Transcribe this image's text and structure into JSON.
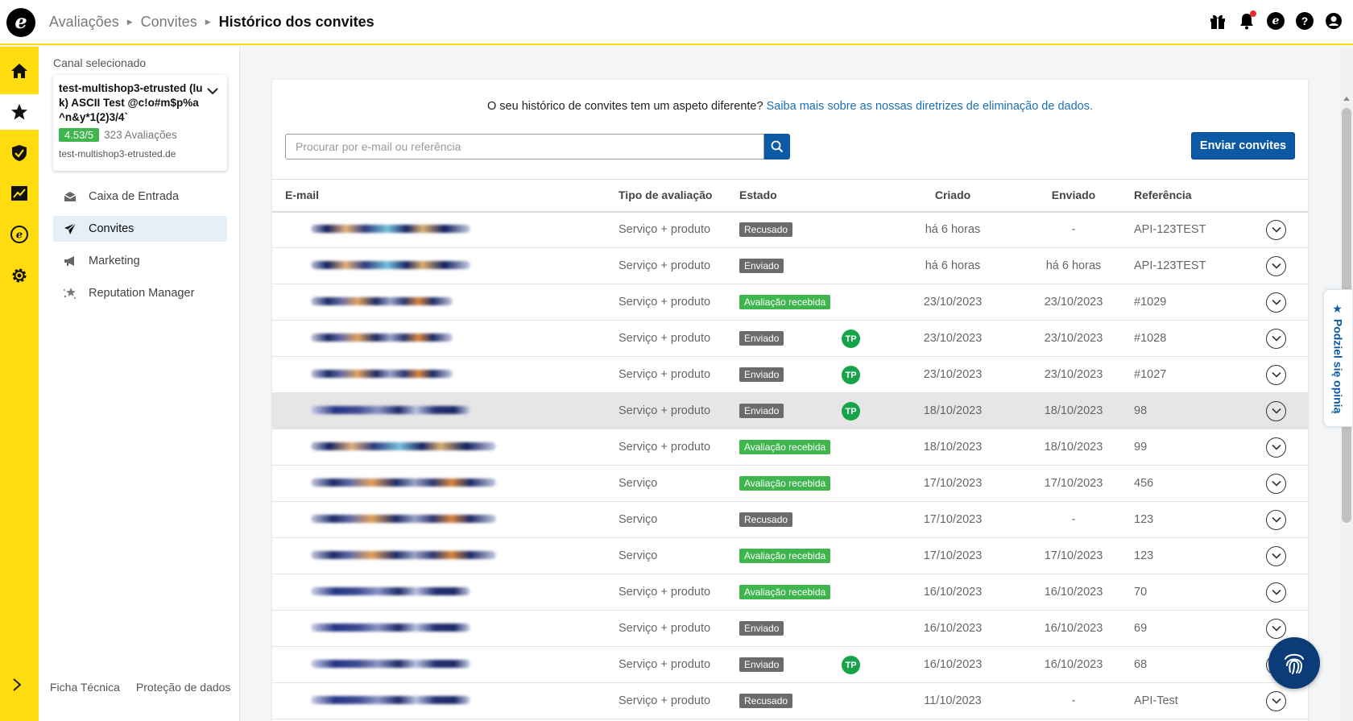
{
  "header": {
    "logo_letter": "e",
    "breadcrumb": [
      "Avaliações",
      "Convites"
    ],
    "current": "Histórico dos convites",
    "icons": [
      "gift-icon",
      "bell-icon",
      "trusted-logo-icon",
      "help-icon",
      "user-icon"
    ]
  },
  "rail": {
    "items": [
      "home-icon",
      "star-icon",
      "shield-icon",
      "chart-icon",
      "trusted-e-icon",
      "gear-icon"
    ],
    "active": "star-icon"
  },
  "sidebar": {
    "channel_label": "Canal selecionado",
    "channel_name": "test-multishop3-etrusted (luk) ASCII Test @c!o#m$p%a^n&y*1(2)3/4`",
    "rating": "4.53/5",
    "review_count": "323 Avaliações",
    "domain": "test-multishop3-etrusted.de",
    "nav": [
      {
        "label": "Caixa de Entrada",
        "icon": "inbox-icon"
      },
      {
        "label": "Convites",
        "icon": "send-icon"
      },
      {
        "label": "Marketing",
        "icon": "megaphone-icon"
      },
      {
        "label": "Reputation Manager",
        "icon": "sparkle-icon"
      }
    ],
    "footer": [
      "Ficha Técnica",
      "Proteção de dados"
    ]
  },
  "main": {
    "notice_text": "O seu histórico de convites tem um aspeto diferente?",
    "notice_link": "Saiba mais sobre as nossas diretrizes de eliminação de dados.",
    "search_placeholder": "Procurar por e-mail ou referência",
    "send_button": "Enviar convites",
    "columns": [
      "E-mail",
      "Tipo de avaliação",
      "Estado",
      "Criado",
      "Enviado",
      "Referência"
    ],
    "rows": [
      {
        "type": "Serviço + produto",
        "state": "Recusado",
        "tp": false,
        "created": "há 6 horas",
        "sent": "-",
        "ref": "API-123TEST",
        "mail_width": 198,
        "variant": "c"
      },
      {
        "type": "Serviço + produto",
        "state": "Enviado",
        "tp": false,
        "created": "há 6 horas",
        "sent": "há 6 horas",
        "ref": "API-123TEST",
        "mail_width": 198,
        "variant": "c"
      },
      {
        "type": "Serviço + produto",
        "state": "Avaliação recebida",
        "tp": false,
        "created": "23/10/2023",
        "sent": "23/10/2023",
        "ref": "#1029",
        "mail_width": 176,
        "variant": "a"
      },
      {
        "type": "Serviço + produto",
        "state": "Enviado",
        "tp": true,
        "created": "23/10/2023",
        "sent": "23/10/2023",
        "ref": "#1028",
        "mail_width": 176,
        "variant": "a"
      },
      {
        "type": "Serviço + produto",
        "state": "Enviado",
        "tp": true,
        "created": "23/10/2023",
        "sent": "23/10/2023",
        "ref": "#1027",
        "mail_width": 176,
        "variant": "a"
      },
      {
        "type": "Serviço + produto",
        "state": "Enviado",
        "tp": true,
        "created": "18/10/2023",
        "sent": "18/10/2023",
        "ref": "98",
        "mail_width": 198,
        "variant": "b",
        "highlight": true
      },
      {
        "type": "Serviço + produto",
        "state": "Avaliação recebida",
        "tp": false,
        "created": "18/10/2023",
        "sent": "18/10/2023",
        "ref": "99",
        "mail_width": 230,
        "variant": "c"
      },
      {
        "type": "Serviço",
        "state": "Avaliação recebida",
        "tp": false,
        "created": "17/10/2023",
        "sent": "17/10/2023",
        "ref": "456",
        "mail_width": 230,
        "variant": "a"
      },
      {
        "type": "Serviço",
        "state": "Recusado",
        "tp": false,
        "created": "17/10/2023",
        "sent": "-",
        "ref": "123",
        "mail_width": 230,
        "variant": "a"
      },
      {
        "type": "Serviço",
        "state": "Avaliação recebida",
        "tp": false,
        "created": "17/10/2023",
        "sent": "17/10/2023",
        "ref": "123",
        "mail_width": 230,
        "variant": "a"
      },
      {
        "type": "Serviço + produto",
        "state": "Avaliação recebida",
        "tp": false,
        "created": "16/10/2023",
        "sent": "16/10/2023",
        "ref": "70",
        "mail_width": 198,
        "variant": "b"
      },
      {
        "type": "Serviço + produto",
        "state": "Enviado",
        "tp": false,
        "created": "16/10/2023",
        "sent": "16/10/2023",
        "ref": "69",
        "mail_width": 198,
        "variant": "b"
      },
      {
        "type": "Serviço + produto",
        "state": "Enviado",
        "tp": true,
        "created": "16/10/2023",
        "sent": "16/10/2023",
        "ref": "68",
        "mail_width": 198,
        "variant": "b"
      },
      {
        "type": "Serviço + produto",
        "state": "Recusado",
        "tp": false,
        "created": "11/10/2023",
        "sent": "-",
        "ref": "API-Test",
        "mail_width": 198,
        "variant": "b"
      }
    ],
    "tp_label": "TP"
  },
  "feedback_tab": "★ Podziel się opinią",
  "colors": {
    "brand_yellow": "#ffdc0f",
    "primary_blue": "#0c5aa6",
    "success_green": "#3eb54d",
    "neutral_badge": "#6b6b6b"
  }
}
